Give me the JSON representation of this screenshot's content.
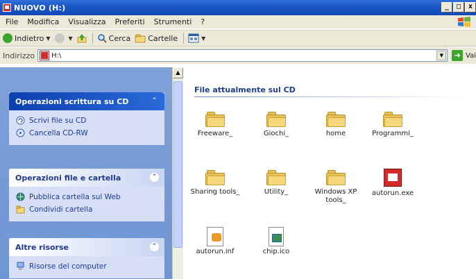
{
  "window": {
    "title": "NUOVO (H:)",
    "buttons": [
      "_",
      "□",
      "x"
    ]
  },
  "menu": [
    "File",
    "Modifica",
    "Visualizza",
    "Preferiti",
    "Strumenti",
    "?"
  ],
  "toolbar": {
    "back": "Indietro",
    "search": "Cerca",
    "folders": "Cartelle"
  },
  "address": {
    "label": "Indirizzo",
    "value": "H:\\",
    "go": "Vai"
  },
  "taskpane": {
    "cd_tasks": {
      "title": "Operazioni scrittura su CD",
      "items": [
        "Scrivi file su CD",
        "Cancella CD-RW"
      ]
    },
    "file_tasks": {
      "title": "Operazioni file e cartella",
      "items": [
        "Pubblica cartella sul Web",
        "Condividi cartella"
      ]
    },
    "other": {
      "title": "Altre risorse",
      "items": [
        "Risorse del computer"
      ]
    }
  },
  "content": {
    "section_title": "File attualmente sul CD",
    "files": [
      {
        "name": "Freeware_",
        "type": "folder"
      },
      {
        "name": "Giochi_",
        "type": "folder"
      },
      {
        "name": "home",
        "type": "folder"
      },
      {
        "name": "Programmi_",
        "type": "folder"
      },
      {
        "name": "Sharing tools_",
        "type": "folder"
      },
      {
        "name": "Utility_",
        "type": "folder"
      },
      {
        "name": "Windows XP tools_",
        "type": "folder"
      },
      {
        "name": "autorun.exe",
        "type": "exe"
      },
      {
        "name": "autorun.inf",
        "type": "inf"
      },
      {
        "name": "chip.ico",
        "type": "ico"
      }
    ]
  },
  "colors": {
    "titlebar": "#1c58c8",
    "taskpane_bg": "#7ea1d8",
    "link_text": "#1b3a96",
    "folder": "#e8c254"
  }
}
